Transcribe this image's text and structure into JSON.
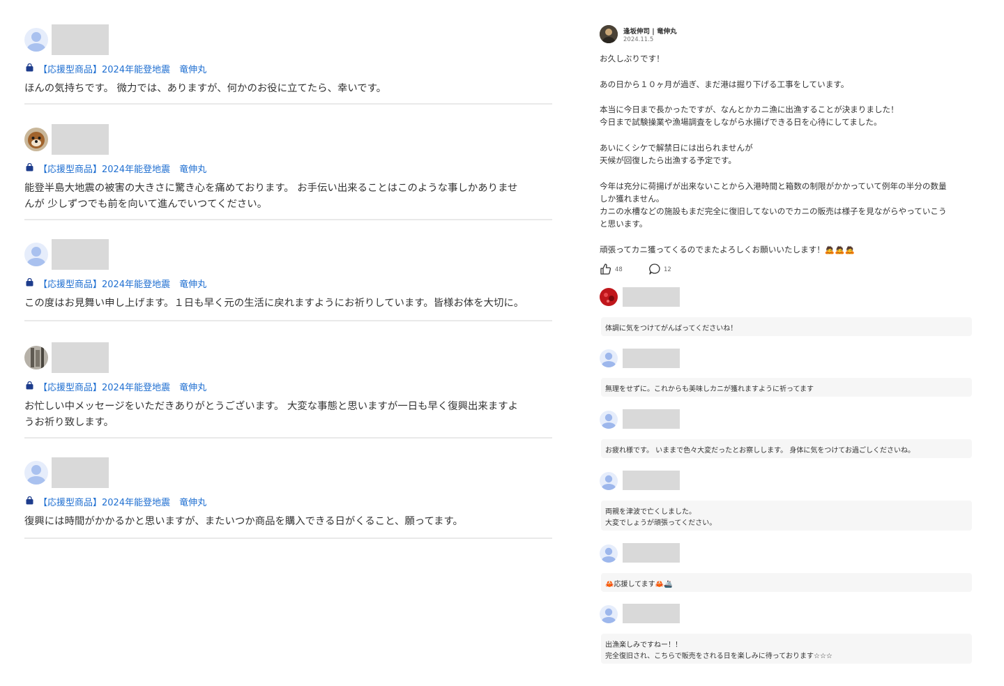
{
  "left_reviews": [
    {
      "product": "【応援型商品】2024年能登地震　竜伸丸",
      "lines": [
        "ほんの気持ちです。 微力では、ありますが、何かのお役に立てたら、幸いです。"
      ]
    },
    {
      "product": "【応援型商品】2024年能登地震　竜伸丸",
      "lines": [
        "能登半島大地震の被害の大きさに驚き心を痛めております。 お手伝い出来ることはこのような事しかありませ",
        "んが 少しずつでも前を向いて進んでいつてください。"
      ]
    },
    {
      "product": "【応援型商品】2024年能登地震　竜伸丸",
      "lines": [
        "この度はお見舞い申し上げます。１日も早く元の生活に戻れますようにお祈りしています。皆様お体を大切に。"
      ]
    },
    {
      "product": "【応援型商品】2024年能登地震　竜伸丸",
      "lines": [
        "お忙しい中メッセージをいただきありがとうございます。 大変な事態と思いますが一日も早く復興出来ますよ",
        "うお祈り致します。"
      ]
    },
    {
      "product": "【応援型商品】2024年能登地震　竜伸丸",
      "lines": [
        "復興には時間がかかるかと思いますが、またいつか商品を購入できる日がくること、願ってます。"
      ]
    }
  ],
  "post": {
    "author": "逢坂伸司 | 竜伸丸",
    "date": "2024.11.5",
    "lines": [
      "お久しぶりです！",
      "あの日から１０ヶ月が過ぎ、まだ港は掘り下げる工事をしています。",
      "本当に今日まで長かったですが、なんとかカニ漁に出漁することが決まりました！",
      "今日まで試験操業や漁場調査をしながら水揚げできる日を心待にしてました。",
      "あいにくシケで解禁日には出られませんが",
      "天候が回復したら出漁する予定です。",
      "今年は充分に荷揚げが出来ないことから入港時間と箱数の制限がかかっていて例年の半分の数量",
      "しか獲れません。",
      "カニの水槽などの施設もまだ完全に復旧してないのでカニの販売は様子を見ながらやっていこう",
      "と思います。",
      "頑張ってカニ獲ってくるのでまたよろしくお願いいたします！🙇🙇🙇"
    ],
    "likes": "48",
    "comments_count": "12"
  },
  "comments": [
    {
      "lines": [
        "体調に気をつけてがんばってくださいね！"
      ]
    },
    {
      "lines": [
        "無理をせずに。これからも美味しカニが獲れますように祈ってます"
      ]
    },
    {
      "lines": [
        "お疲れ様です。 いままで色々大変だったとお察しします。 身体に気をつけてお過ごしくださいね。"
      ]
    },
    {
      "lines": [
        "両親を津波で亡くしました。",
        "大変でしょうが頑張ってください。"
      ]
    },
    {
      "lines": [
        "🦀応援してます🦀🚢"
      ]
    },
    {
      "lines": [
        "出漁楽しみですねー！！",
        "完全復旧され、こちらで販売をされる日を楽しみに待っております☆☆☆"
      ]
    }
  ],
  "colors": {
    "accent": "#1f6fd1",
    "avatar_default": "#c7d6f5",
    "placeholder": "#d9d9d9"
  }
}
